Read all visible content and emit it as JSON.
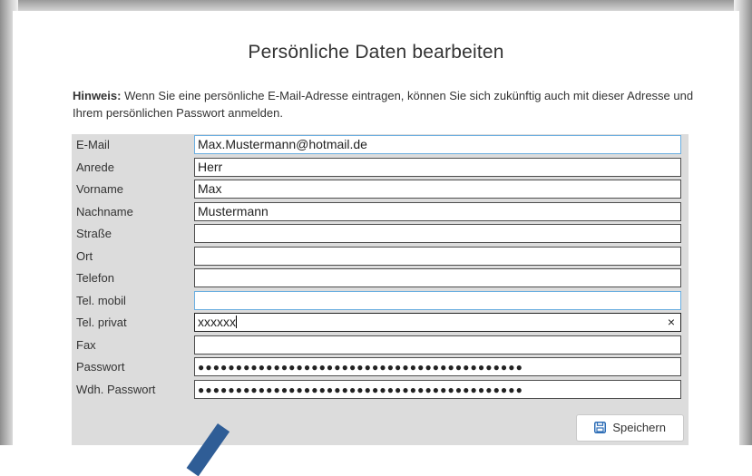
{
  "dialog": {
    "title": "Persönliche Daten bearbeiten",
    "hint_label": "Hinweis:",
    "hint_text": "Wenn Sie eine persönliche E-Mail-Adresse eintragen, können Sie sich zukünftig auch mit dieser Adresse und Ihrem persönlichen Passwort anmelden."
  },
  "fields": [
    {
      "label": "E-Mail",
      "value": "Max.Mustermann@hotmail.de"
    },
    {
      "label": "Anrede",
      "value": "Herr"
    },
    {
      "label": "Vorname",
      "value": "Max"
    },
    {
      "label": "Nachname",
      "value": "Mustermann"
    },
    {
      "label": "Straße",
      "value": ""
    },
    {
      "label": "Ort",
      "value": ""
    },
    {
      "label": "Telefon",
      "value": ""
    },
    {
      "label": "Tel. mobil",
      "value": ""
    },
    {
      "label": "Tel. privat",
      "value": "xxxxxx",
      "clear": "×"
    },
    {
      "label": "Fax",
      "value": ""
    },
    {
      "label": "Passwort",
      "value": "●●●●●●●●●●●●●●●●●●●●●●●●●●●●●●●●●●●●●●●●●●●"
    },
    {
      "label": "Wdh. Passwort",
      "value": "●●●●●●●●●●●●●●●●●●●●●●●●●●●●●●●●●●●●●●●●●●●"
    }
  ],
  "buttons": {
    "save_label": "Speichern",
    "save_icon": "save-icon"
  },
  "colors": {
    "form_background": "#dcdcdc",
    "focus_border": "#6aaee0",
    "annotation_arrow": "#2f5d96"
  }
}
